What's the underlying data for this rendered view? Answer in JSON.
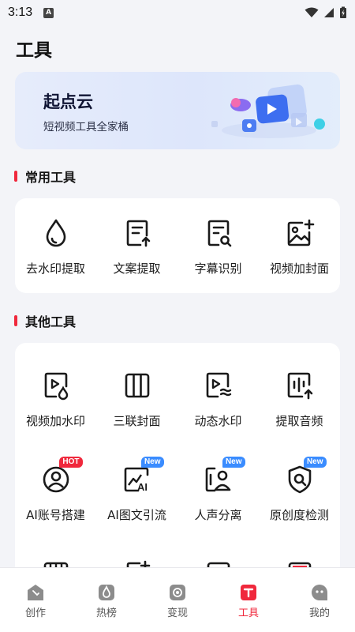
{
  "status_bar": {
    "time": "3:13",
    "notification_glyph": "A"
  },
  "page_title": "工具",
  "banner": {
    "title": "起点云",
    "subtitle": "短视频工具全家桶"
  },
  "sections": {
    "common": {
      "title": "常用工具"
    },
    "other": {
      "title": "其他工具"
    }
  },
  "common_tools": [
    {
      "label": "去水印提取",
      "icon": "droplet-icon"
    },
    {
      "label": "文案提取",
      "icon": "document-upload-icon"
    },
    {
      "label": "字幕识别",
      "icon": "document-search-icon"
    },
    {
      "label": "视频加封面",
      "icon": "image-add-icon"
    }
  ],
  "other_tools": [
    {
      "label": "视频加水印",
      "icon": "video-droplet-icon"
    },
    {
      "label": "三联封面",
      "icon": "triptych-icon"
    },
    {
      "label": "动态水印",
      "icon": "video-wave-icon"
    },
    {
      "label": "提取音频",
      "icon": "audio-extract-icon"
    },
    {
      "label": "AI账号搭建",
      "icon": "account-icon",
      "tag": "HOT"
    },
    {
      "label": "AI图文引流",
      "icon": "ai-chart-icon",
      "tag": "New"
    },
    {
      "label": "人声分离",
      "icon": "voice-separate-icon",
      "tag": "New"
    },
    {
      "label": "原创度检测",
      "icon": "shield-search-icon",
      "tag": "New"
    }
  ],
  "tabbar": [
    {
      "label": "创作",
      "icon": "create-icon"
    },
    {
      "label": "热榜",
      "icon": "flame-icon"
    },
    {
      "label": "变现",
      "icon": "coin-icon"
    },
    {
      "label": "工具",
      "icon": "tools-icon",
      "active": true
    },
    {
      "label": "我的",
      "icon": "profile-icon"
    }
  ],
  "colors": {
    "accent": "#f0283c",
    "new_tag": "#3a8cff",
    "background": "#f3f4f8"
  }
}
